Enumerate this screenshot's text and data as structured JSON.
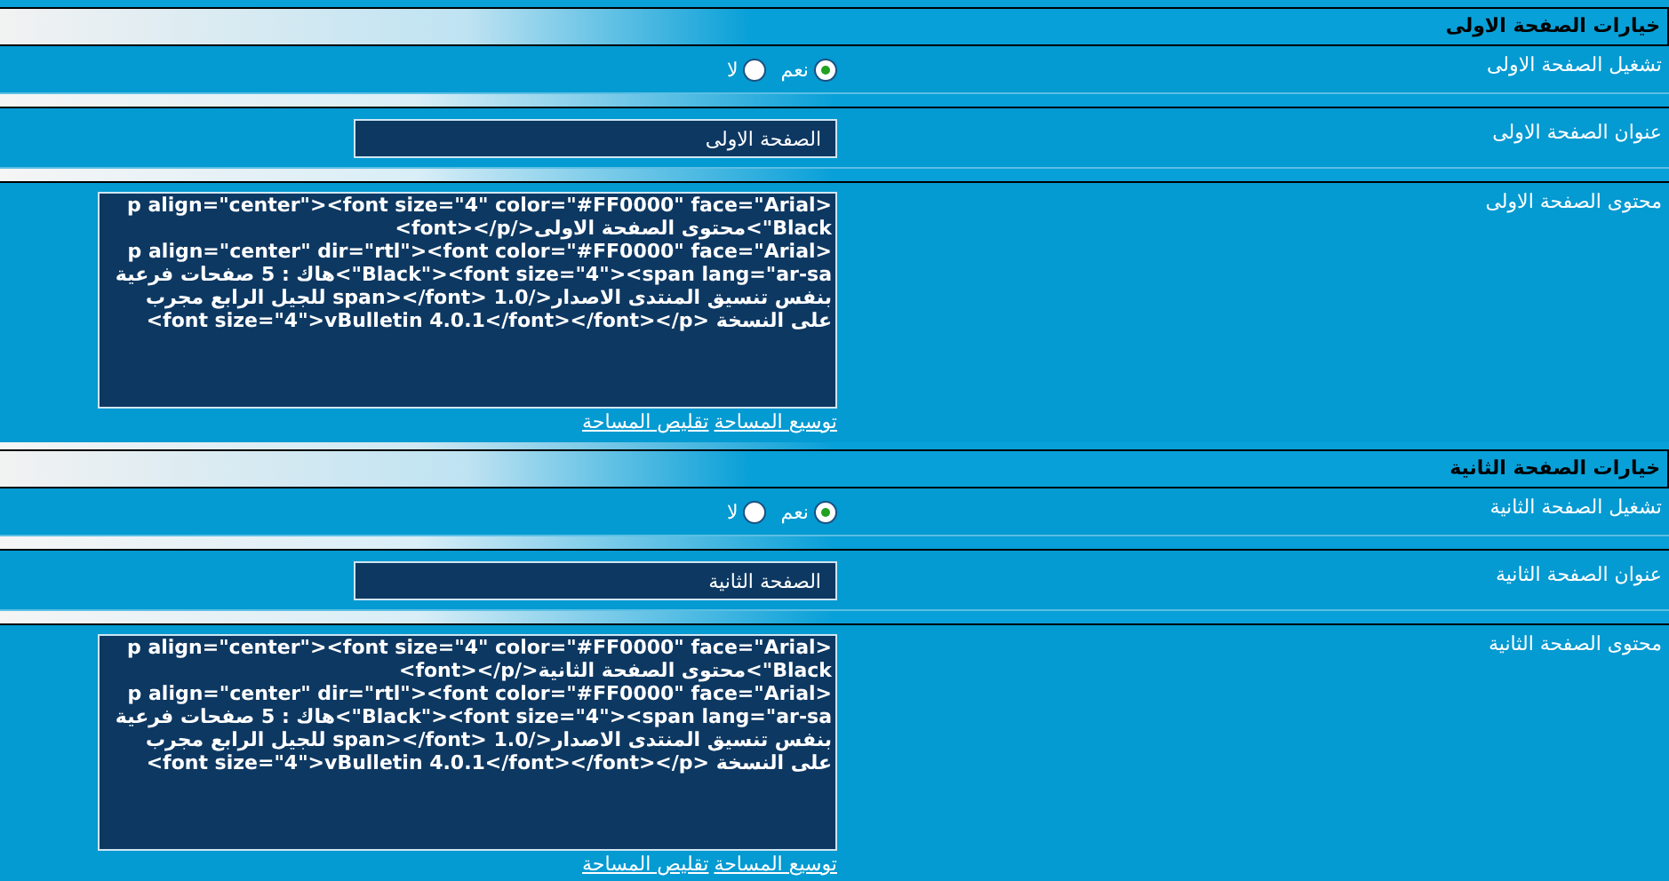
{
  "sections": [
    {
      "title": "خيارات الصفحة الاولى",
      "rows": [
        {
          "kind": "radio",
          "label": "تشغيل الصفحة الاولى",
          "options": [
            {
              "label": "نعم",
              "selected": true
            },
            {
              "label": "لا",
              "selected": false
            }
          ]
        },
        {
          "kind": "text",
          "label": "عنوان الصفحة الاولى",
          "value": "الصفحة الاولى"
        },
        {
          "kind": "textarea",
          "label": "محتوى الصفحة الاولى",
          "value": "<p align=\"center\"><font size=\"4\" color=\"#FF0000\" face=\"Arial Black\">محتوى الصفحة الاولى</font></p>\n<p align=\"center\" dir=\"rtl\"><font color=\"#FF0000\" face=\"Arial Black\"><font size=\"4\"><span lang=\"ar-sa\">هاك : 5 صفحات فرعية بنفس تنسيق المنتدى الاصدار</span></font> 1.0 للجيل الرابع مجرب على النسخة <font size=\"4\">vBulletin 4.0.1</font></font></p>",
          "links": [
            "توسيع المساحة",
            "تقليص المساحة"
          ]
        }
      ]
    },
    {
      "title": "خيارات الصفحة الثانية",
      "rows": [
        {
          "kind": "radio",
          "label": "تشغيل الصفحة الثانية",
          "options": [
            {
              "label": "نعم",
              "selected": true
            },
            {
              "label": "لا",
              "selected": false
            }
          ]
        },
        {
          "kind": "text",
          "label": "عنوان الصفحة الثانية",
          "value": "الصفحة الثانية"
        },
        {
          "kind": "textarea",
          "label": "محتوى الصفحة الثانية",
          "value": "<p align=\"center\"><font size=\"4\" color=\"#FF0000\" face=\"Arial Black\">محتوى الصفحة الثانية</font></p>\n<p align=\"center\" dir=\"rtl\"><font color=\"#FF0000\" face=\"Arial Black\"><font size=\"4\"><span lang=\"ar-sa\">هاك : 5 صفحات فرعية بنفس تنسيق المنتدى الاصدار</span></font> 1.0 للجيل الرابع مجرب على النسخة <font size=\"4\">vBulletin 4.0.1</font></font></p>",
          "links": [
            "توسيع المساحة",
            "تقليص المساحة"
          ]
        }
      ]
    }
  ]
}
